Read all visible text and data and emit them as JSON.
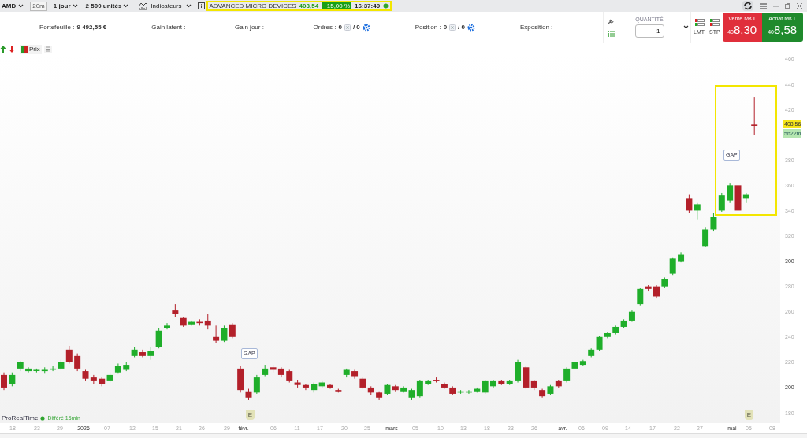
{
  "top_bar": {
    "symbol": "AMD",
    "timeframe": "20m",
    "period": "1 jour",
    "quantity": "2 500 unités",
    "indicators": "Indicateurs",
    "ticker": {
      "name": "ADVANCED MICRO DEVICES",
      "price": "408,54",
      "change": "+15,00 %",
      "time": "16:37:49"
    }
  },
  "account_bar": {
    "stats": [
      {
        "kind": "text",
        "label": "Portefeuille :",
        "value": "9 492,55 €"
      },
      {
        "kind": "text",
        "label": "Gain latent :",
        "value": "-"
      },
      {
        "kind": "text",
        "label": "Gain jour :",
        "value": "-"
      },
      {
        "kind": "counter",
        "label": "Ordres :",
        "value": "0",
        "total": "/ 0"
      },
      {
        "kind": "counter",
        "label": "Position :",
        "value": "0",
        "total": "/ 0"
      },
      {
        "kind": "text",
        "label": "Exposition :",
        "value": "-"
      }
    ]
  },
  "order_panel": {
    "quantity_label": "QUANTITÉ",
    "quantity": "1",
    "limit": "LMT",
    "stop": "STP",
    "sell": {
      "label": "Vente MKT",
      "prefix": "40",
      "price": "8,30"
    },
    "buy": {
      "label": "Achat MKT",
      "prefix": "40",
      "price": "8,58"
    }
  },
  "chart_toolbar": {
    "price_label": "Prix"
  },
  "chart": {
    "y_tick_major": [
      false,
      false,
      false,
      false,
      false,
      false,
      false,
      true,
      false,
      false,
      false,
      false,
      true,
      false
    ],
    "x_labels": [
      {
        "label": "18",
        "major": false
      },
      {
        "label": "23",
        "major": false
      },
      {
        "label": "29",
        "major": false
      },
      {
        "label": "2026",
        "major": true
      },
      {
        "label": "07",
        "major": false
      },
      {
        "label": "12",
        "major": false
      },
      {
        "label": "15",
        "major": false
      },
      {
        "label": "21",
        "major": false
      },
      {
        "label": "26",
        "major": false
      },
      {
        "label": "29",
        "major": false
      },
      {
        "label": "févr.",
        "major": true
      },
      {
        "label": "06",
        "major": false
      },
      {
        "label": "11",
        "major": false
      },
      {
        "label": "17",
        "major": false
      },
      {
        "label": "20",
        "major": false
      },
      {
        "label": "25",
        "major": false
      },
      {
        "label": "mars",
        "major": true
      },
      {
        "label": "05",
        "major": false
      },
      {
        "label": "10",
        "major": false
      },
      {
        "label": "13",
        "major": false
      },
      {
        "label": "18",
        "major": false
      },
      {
        "label": "23",
        "major": false
      },
      {
        "label": "26",
        "major": false
      },
      {
        "label": "avr.",
        "major": true
      },
      {
        "label": "06",
        "major": false
      },
      {
        "label": "09",
        "major": false
      },
      {
        "label": "14",
        "major": false
      },
      {
        "label": "17",
        "major": false
      },
      {
        "label": "22",
        "major": false
      },
      {
        "label": "27",
        "major": false
      },
      {
        "label": "mai",
        "major": true
      },
      {
        "label": "05",
        "major": false
      },
      {
        "label": "08",
        "major": false
      }
    ],
    "chart_data": {
      "type": "candlestick",
      "ylim": [
        171.9,
        463.1
      ],
      "yticks": [
        460,
        440,
        420,
        380,
        360,
        340,
        320,
        300,
        280,
        260,
        240,
        220,
        200,
        180
      ],
      "categories": [
        null,
        null,
        null,
        null,
        null,
        null,
        null,
        null,
        null,
        null,
        null,
        null,
        null,
        null,
        null,
        null,
        null,
        null,
        null,
        null,
        null,
        null,
        null,
        null,
        null,
        null,
        null,
        null,
        null,
        null,
        null,
        null,
        null,
        null,
        null,
        null,
        null,
        null,
        null,
        null,
        null,
        null,
        null,
        null,
        null,
        null,
        null,
        null,
        null,
        null,
        null,
        null,
        null,
        null,
        null,
        null,
        null,
        null,
        null,
        null,
        null,
        null,
        null,
        null,
        null,
        null,
        null,
        null,
        null,
        null,
        null,
        null,
        null,
        null,
        null,
        null,
        null,
        null,
        null,
        null,
        null,
        null,
        null,
        null,
        null,
        null,
        null,
        null,
        null,
        null,
        null,
        null,
        null
      ],
      "ohlc": [
        [
          210,
          212,
          198,
          200
        ],
        [
          203,
          212,
          201,
          210
        ],
        [
          215,
          221,
          213,
          220
        ],
        [
          213,
          216,
          212,
          215
        ],
        [
          214,
          215,
          212,
          214
        ],
        [
          213,
          216,
          211,
          214
        ],
        [
          215,
          217,
          213,
          215
        ],
        [
          215,
          222,
          214,
          220
        ],
        [
          230,
          233,
          219,
          220
        ],
        [
          225,
          227,
          213,
          215
        ],
        [
          213,
          214,
          205,
          207
        ],
        [
          208,
          210,
          203,
          205
        ],
        [
          207,
          208,
          201,
          203
        ],
        [
          205,
          212,
          204,
          210
        ],
        [
          212,
          219,
          211,
          217
        ],
        [
          214,
          220,
          213,
          218
        ],
        [
          225,
          232,
          224,
          230
        ],
        [
          228,
          230,
          224,
          225
        ],
        [
          225,
          232,
          222,
          229
        ],
        [
          232,
          247,
          231,
          245
        ],
        [
          247,
          251,
          246,
          249
        ],
        [
          261,
          266,
          256,
          258
        ],
        [
          255,
          256,
          248,
          249
        ],
        [
          250,
          253,
          249,
          252
        ],
        [
          252,
          254,
          249,
          251
        ],
        [
          253,
          258,
          246,
          249
        ],
        [
          240,
          249,
          235,
          237
        ],
        [
          237,
          249,
          236,
          247
        ],
        [
          250,
          251,
          239,
          240
        ],
        [
          215,
          217,
          196,
          198
        ],
        [
          197,
          199,
          190,
          192
        ],
        [
          196,
          210,
          195,
          208
        ],
        [
          210,
          218,
          209,
          215
        ],
        [
          216,
          218,
          212,
          214
        ],
        [
          215,
          216,
          208,
          210
        ],
        [
          213,
          214,
          204,
          205
        ],
        [
          204,
          206,
          200,
          202
        ],
        [
          202,
          203,
          198,
          200
        ],
        [
          198,
          204,
          196,
          203
        ],
        [
          201,
          205,
          200,
          204
        ],
        [
          202,
          203,
          199,
          200
        ],
        [
          198,
          199,
          196,
          197
        ],
        [
          210,
          215,
          208,
          214
        ],
        [
          213,
          214,
          207,
          209
        ],
        [
          207,
          208,
          199,
          200
        ],
        [
          200,
          201,
          194,
          196
        ],
        [
          196,
          197,
          190,
          192
        ],
        [
          195,
          203,
          194,
          202
        ],
        [
          201,
          202,
          197,
          198
        ],
        [
          197,
          201,
          196,
          200
        ],
        [
          192,
          199,
          190,
          198
        ],
        [
          193,
          206,
          192,
          205
        ],
        [
          203,
          206,
          202,
          205
        ],
        [
          206,
          208,
          204,
          205
        ],
        [
          203,
          204,
          199,
          200
        ],
        [
          200,
          201,
          194,
          195
        ],
        [
          196,
          198,
          195,
          197
        ],
        [
          196,
          198,
          195,
          197
        ],
        [
          197,
          200,
          196,
          199
        ],
        [
          196,
          206,
          195,
          205
        ],
        [
          201,
          206,
          200,
          205
        ],
        [
          205,
          206,
          202,
          203
        ],
        [
          203,
          206,
          202,
          205
        ],
        [
          205,
          222,
          204,
          220
        ],
        [
          216,
          217,
          199,
          200
        ],
        [
          205,
          206,
          198,
          200
        ],
        [
          198,
          199,
          192,
          193
        ],
        [
          195,
          202,
          194,
          201
        ],
        [
          205,
          206,
          200,
          201
        ],
        [
          205,
          216,
          204,
          215
        ],
        [
          215,
          223,
          214,
          220
        ],
        [
          218,
          222,
          217,
          221
        ],
        [
          225,
          231,
          224,
          230
        ],
        [
          230,
          241,
          229,
          240
        ],
        [
          240,
          244,
          239,
          243
        ],
        [
          243,
          249,
          242,
          248
        ],
        [
          248,
          254,
          247,
          253
        ],
        [
          253,
          261,
          252,
          260
        ],
        [
          266,
          279,
          265,
          278
        ],
        [
          280,
          281,
          276,
          278
        ],
        [
          280,
          281,
          271,
          272
        ],
        [
          280,
          287,
          279,
          286
        ],
        [
          290,
          303,
          289,
          302
        ],
        [
          300,
          307,
          299,
          305
        ],
        [
          350,
          353,
          338,
          340
        ],
        [
          340,
          346,
          333,
          345
        ],
        [
          312,
          327,
          311,
          325
        ],
        [
          325,
          338,
          324,
          335
        ],
        [
          340,
          354,
          339,
          352
        ],
        [
          348,
          362,
          346,
          360
        ],
        [
          360,
          361,
          338,
          340
        ],
        [
          350,
          354,
          346,
          353
        ],
        [
          408,
          430,
          400,
          407
        ]
      ]
    },
    "last_price": "408,56",
    "countdown": "5h22m",
    "gap_labels": [
      "GAP",
      "GAP"
    ],
    "event_markers": [
      "E",
      "E"
    ]
  },
  "footer": {
    "brand": "ProRealTime",
    "delay": "Différé 15min"
  }
}
